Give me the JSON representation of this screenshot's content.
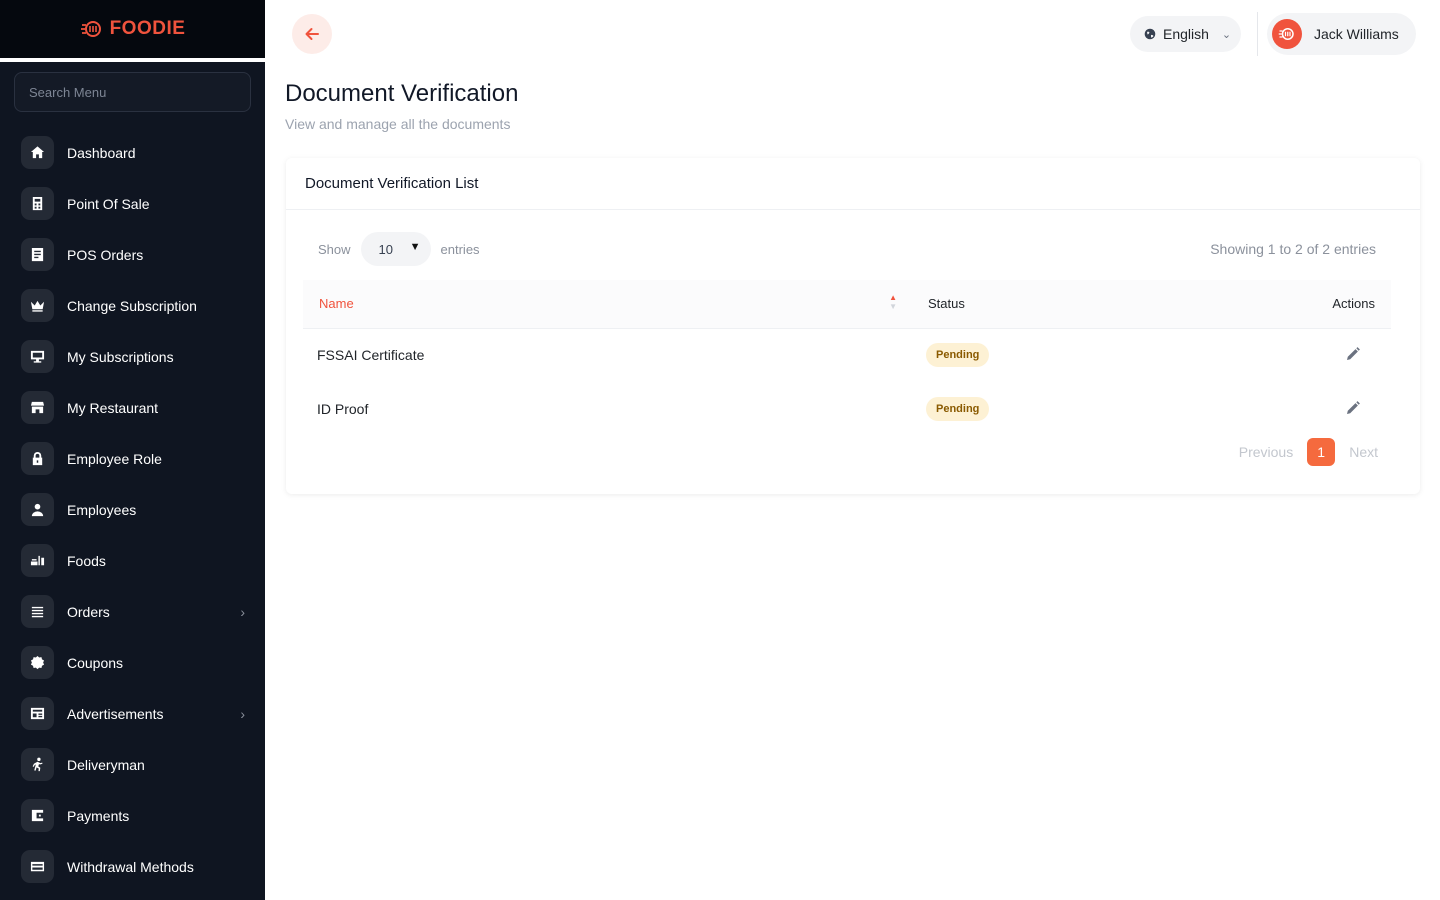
{
  "brand": {
    "name": "FOODIE",
    "accent": "#f0533d"
  },
  "sidebar": {
    "search_placeholder": "Search Menu",
    "items": [
      {
        "label": "Dashboard",
        "icon": "home-icon"
      },
      {
        "label": "Point Of Sale",
        "icon": "calculator-icon"
      },
      {
        "label": "POS Orders",
        "icon": "receipt-icon"
      },
      {
        "label": "Change Subscription",
        "icon": "crown-icon"
      },
      {
        "label": "My Subscriptions",
        "icon": "monitor-icon"
      },
      {
        "label": "My Restaurant",
        "icon": "store-icon"
      },
      {
        "label": "Employee Role",
        "icon": "lock-icon"
      },
      {
        "label": "Employees",
        "icon": "person-icon"
      },
      {
        "label": "Foods",
        "icon": "food-icon"
      },
      {
        "label": "Orders",
        "icon": "list-icon",
        "has_children": true
      },
      {
        "label": "Coupons",
        "icon": "coupon-icon"
      },
      {
        "label": "Advertisements",
        "icon": "ad-icon",
        "has_children": true
      },
      {
        "label": "Deliveryman",
        "icon": "runner-icon"
      },
      {
        "label": "Payments",
        "icon": "wallet-icon"
      },
      {
        "label": "Withdrawal Methods",
        "icon": "card-icon"
      }
    ]
  },
  "topbar": {
    "language": "English",
    "user_name": "Jack Williams"
  },
  "page": {
    "title": "Document Verification",
    "subtitle": "View and manage all the documents"
  },
  "card": {
    "title": "Document Verification List",
    "show_label": "Show",
    "entries_value": "10",
    "entries_label": "entries",
    "info": "Showing 1 to 2 of 2 entries",
    "columns": {
      "name": "Name",
      "status": "Status",
      "actions": "Actions"
    },
    "rows": [
      {
        "name": "FSSAI Certificate",
        "status": "Pending"
      },
      {
        "name": "ID Proof",
        "status": "Pending"
      }
    ],
    "pagination": {
      "previous": "Previous",
      "current": "1",
      "next": "Next"
    }
  }
}
